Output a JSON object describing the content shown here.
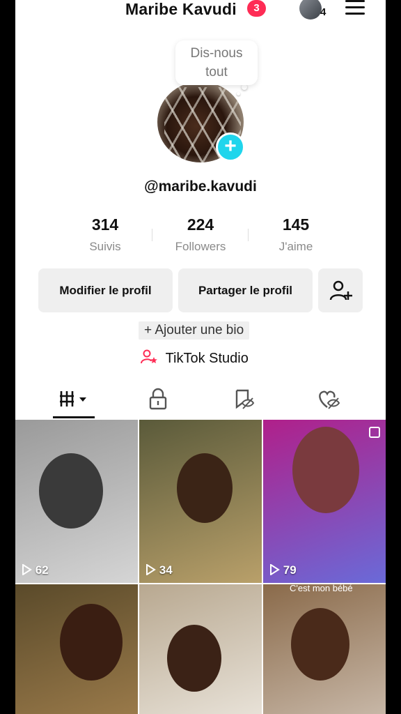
{
  "header": {
    "display_name": "Maribe Kavudi",
    "notification_count": "3",
    "account_switch_count": "4"
  },
  "profile": {
    "bubble_line1": "Dis-nous",
    "bubble_line2": "tout",
    "handle": "@maribe.kavudi",
    "add_symbol": "+"
  },
  "stats": [
    {
      "value": "314",
      "label": "Suivis"
    },
    {
      "value": "224",
      "label": "Followers"
    },
    {
      "value": "145",
      "label": "J'aime"
    }
  ],
  "actions": {
    "edit_profile": "Modifier le profil",
    "share_profile": "Partager le profil"
  },
  "bio_prompt": "+ Ajouter une bio",
  "studio_label": "TikTok Studio",
  "tabs": [
    "videos-tab",
    "private-tab",
    "reposts-tab",
    "liked-tab"
  ],
  "videos": [
    {
      "views": "62",
      "colors": [
        "#9a9a9a",
        "#d5d5d5"
      ]
    },
    {
      "views": "34",
      "colors": [
        "#5a5a3a",
        "#b9a06a"
      ]
    },
    {
      "views": "79",
      "colors": [
        "#b0208a",
        "#6a6ad8"
      ]
    },
    {
      "views": "",
      "caption": "",
      "colors": [
        "#5a4a2a",
        "#9a7a4a"
      ]
    },
    {
      "views": "",
      "colors": [
        "#b8a890",
        "#e8e2d8"
      ]
    },
    {
      "views": "",
      "caption": "C'est mon bébé",
      "colors": [
        "#8a6a4a",
        "#c8b8a8"
      ]
    }
  ],
  "colors": {
    "accent_pink": "#fe2c55",
    "accent_cyan": "#20d5ec"
  }
}
